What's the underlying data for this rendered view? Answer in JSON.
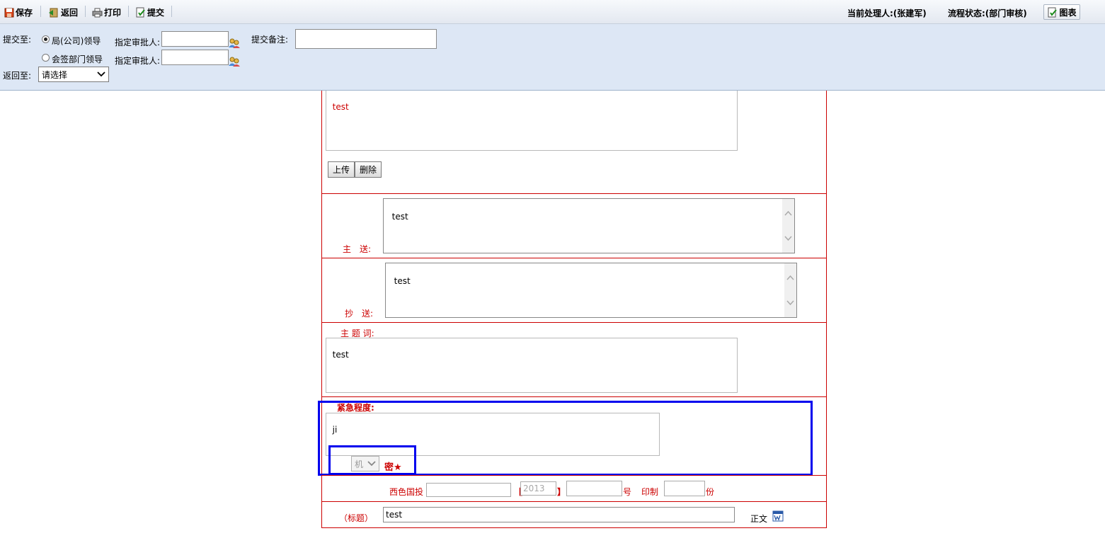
{
  "toolbar": {
    "save_label": "保存",
    "back_label": "返回",
    "print_label": "打印",
    "submit_label": "提交",
    "handler_text": "当前处理人:(张建军)",
    "status_text": "流程状态:(部门审核)",
    "chart_label": "图表"
  },
  "submit_panel": {
    "submit_to_label": "提交至:",
    "option_leader": "局(公司)领导",
    "option_countersign": "会签部门领导",
    "approver_label_1": "指定审批人:",
    "approver_label_2": "指定审批人:",
    "remark_label": "提交备注:",
    "return_to_label": "返回至:",
    "return_select_value": "请选择",
    "selected_option": "局(公司)领导"
  },
  "form": {
    "attachment_text": "test",
    "upload_label": "上传",
    "delete_label": "删除",
    "main_send_label": "主　送:",
    "main_send_value": "test",
    "cc_label": "抄　送:",
    "cc_value": "test",
    "keywords_label": "主 题 词:",
    "keywords_value": "test",
    "urgency_label": "紧急程度:",
    "urgency_value": "ji",
    "secret_select_value": "机",
    "secret_suffix": "密★",
    "doc_prefix": "西色国投",
    "bracket_open": "【",
    "year_value": "2013",
    "bracket_close": "】",
    "number_suffix": "号",
    "print_label": "印制",
    "copies_suffix": "份",
    "title_label": "（标题）",
    "title_value": "test",
    "body_label": "正文"
  },
  "colors": {
    "accent_red": "#cc0000",
    "highlight_blue": "#0000ee",
    "panel_bg": "#dde7f5"
  }
}
